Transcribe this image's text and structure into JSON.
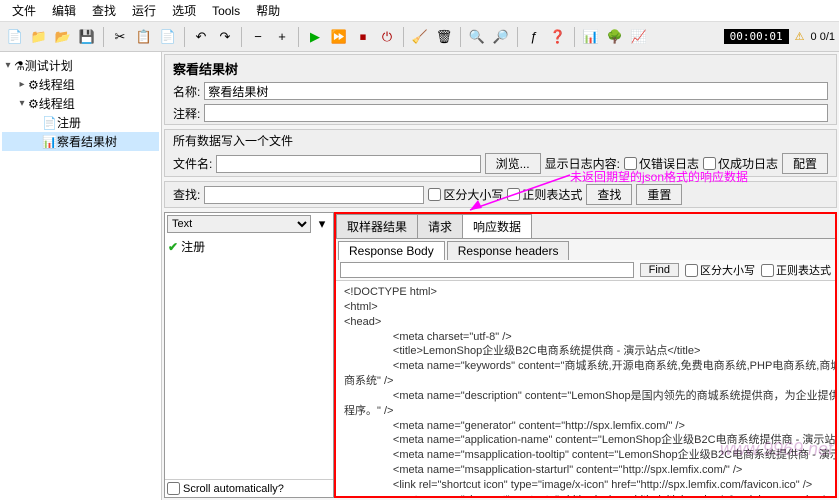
{
  "menu": {
    "items": [
      "文件",
      "编辑",
      "查找",
      "运行",
      "选项",
      "Tools",
      "帮助"
    ]
  },
  "toolbar": {
    "timer": "00:00:01",
    "warn": "⚠",
    "counter": "0 0/1"
  },
  "tree": {
    "root": "测试计划",
    "tg1": "线程组",
    "tg2": "线程组",
    "reg": "注册",
    "vrt": "察看结果树"
  },
  "panel": {
    "title": "察看结果树",
    "name_label": "名称:",
    "name_value": "察看结果树",
    "comment_label": "注释:",
    "file_header": "所有数据写入一个文件",
    "filename_label": "文件名:",
    "browse": "浏览...",
    "log_label": "显示日志内容:",
    "only_error": "仅错误日志",
    "only_success": "仅成功日志",
    "config": "配置",
    "search_label": "查找:",
    "case_sens": "区分大小写",
    "regex": "正则表达式",
    "search_btn": "查找",
    "reset_btn": "重置"
  },
  "results": {
    "render_option": "Text",
    "item1": "注册",
    "scroll_auto": "Scroll automatically?"
  },
  "annotation": "未返回期望的json格式的响应数据",
  "tabs": {
    "sampler": "取样器结果",
    "request": "请求",
    "response": "响应数据"
  },
  "subtabs": {
    "body": "Response Body",
    "headers": "Response headers"
  },
  "find": {
    "btn": "Find",
    "case_sens": "区分大小写",
    "regex": "正则表达式"
  },
  "response_body": "<!DOCTYPE html>\n<html>\n<head>\n                <meta charset=\"utf-8\" />\n                <title>LemonShop企业级B2C电商系统提供商 - 演示站点</title>\n                <meta name=\"keywords\" content=\"商城系统,开源电商系统,免费电商系统,PHP电商系统,商城系统,B2C电商系统,B2B2C电\n商系统\" />\n                <meta name=\"description\" content=\"LemonShop是国内领先的商城系统提供商，为企业提供php商城系统、微信商城、小\n程序。\" />\n                <meta name=\"generator\" content=\"http://spx.lemfix.com/\" />\n                <meta name=\"application-name\" content=\"LemonShop企业级B2C电商系统提供商 - 演示站点\" />\n                <meta name=\"msapplication-tooltip\" content=\"LemonShop企业级B2C电商系统提供商 - 演示站点\" />\n                <meta name=\"msapplication-starturl\" content=\"http://spx.lemfix.com/\" />\n                <link rel=\"shortcut icon\" type=\"image/x-icon\" href=\"http://spx.lemfix.com/favicon.ico\" />\n                <meta name=\"viewport\" content=\"width=device-width, initial-scale=1.0, minimum-scale=1, maximum-scale=1\"\n >\n                <meta name=\"apple-mobile-web-app-capable\" content=\"yes\">\n                <meta name=\"apple-mobile-web-app-title\" content=\"LemonShop\">\n                <link rel=\"apple-touch-icon\" href=\"http://spx.lemfix.com/static/upload/images/common/2022/01/05/16413858068428849.jpg\">\n                <link rel=\"apple-touch-icon-precomposed\" href=\"http://spx.lemfix.com/static/upload/images/common/2022/01/05/16413858068428\n9.jpg\">",
  "watermark": "www.9969.net"
}
